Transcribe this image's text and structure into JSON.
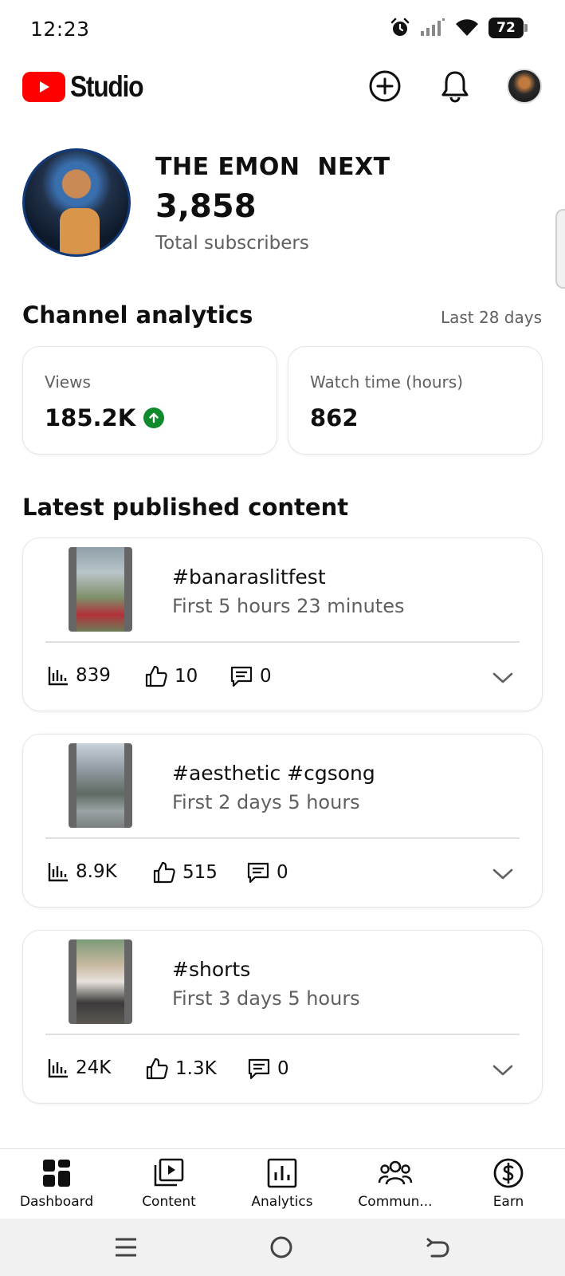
{
  "status_bar": {
    "time": "12:23",
    "battery": "72"
  },
  "header": {
    "logo_text": "Studio",
    "brand_color": "#ff0000"
  },
  "channel": {
    "name": "THE EMON  NEXT",
    "subscriber_count": "3,858",
    "subscriber_label": "Total subscribers"
  },
  "analytics": {
    "title": "Channel analytics",
    "range": "Last 28 days",
    "cards": [
      {
        "label": "Views",
        "value": "185.2K",
        "trend": "up"
      },
      {
        "label": "Watch time (hours)",
        "value": "862"
      }
    ],
    "up_color": "#0f8a2c"
  },
  "latest": {
    "title": "Latest published content",
    "items": [
      {
        "title": "#banaraslitfest",
        "period": "First 5 hours 23 minutes",
        "views": "839",
        "likes": "10",
        "comments": "0"
      },
      {
        "title": "#aesthetic #cgsong",
        "period": "First 2 days 5 hours",
        "views": "8.9K",
        "likes": "515",
        "comments": "0"
      },
      {
        "title": "#shorts",
        "period": "First 3 days 5 hours",
        "views": "24K",
        "likes": "1.3K",
        "comments": "0"
      }
    ]
  },
  "bottom_nav": {
    "items": [
      {
        "label": "Dashboard",
        "icon": "dashboard-icon",
        "active": true
      },
      {
        "label": "Content",
        "icon": "content-icon"
      },
      {
        "label": "Analytics",
        "icon": "analytics-icon"
      },
      {
        "label": "Commun...",
        "icon": "community-icon"
      },
      {
        "label": "Earn",
        "icon": "earn-icon"
      }
    ]
  }
}
